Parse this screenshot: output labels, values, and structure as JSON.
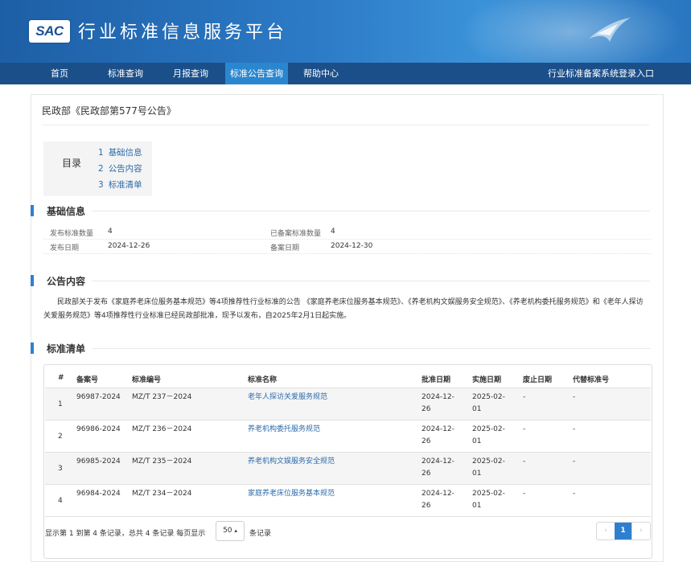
{
  "header": {
    "logo_text": "SAC",
    "site_title": "行业标准信息服务平台"
  },
  "nav": {
    "items": [
      "首页",
      "标准查询",
      "月报查询",
      "标准公告查询",
      "帮助中心"
    ],
    "active_index": 3,
    "right_link": "行业标准备案系统登录入口"
  },
  "page": {
    "title": "民政部《民政部第577号公告》"
  },
  "toc": {
    "label": "目录",
    "items": [
      {
        "num": "1",
        "label": "基础信息"
      },
      {
        "num": "2",
        "label": "公告内容"
      },
      {
        "num": "3",
        "label": "标准清单"
      }
    ]
  },
  "basic_info": {
    "title": "基础信息",
    "fields": [
      {
        "label": "发布标准数量",
        "value": "4"
      },
      {
        "label": "已备案标准数量",
        "value": "4"
      },
      {
        "label": "发布日期",
        "value": "2024-12-26"
      },
      {
        "label": "备案日期",
        "value": "2024-12-30"
      }
    ]
  },
  "notice": {
    "title": "公告内容",
    "text": "民政部关于发布《家庭养老床位服务基本规范》等4项推荐性行业标准的公告 《家庭养老床位服务基本规范》、《养老机构文娱服务安全规范》、《养老机构委托服务规范》和《老年人探访关爱服务规范》等4项推荐性行业标准已经民政部批准，现予以发布，自2025年2月1日起实施。"
  },
  "standards": {
    "title": "标准清单",
    "columns": [
      "#",
      "备案号",
      "标准编号",
      "标准名称",
      "批准日期",
      "实施日期",
      "废止日期",
      "代替标准号"
    ],
    "rows": [
      {
        "idx": "1",
        "record": "96987-2024",
        "code": "MZ/T 237－2024",
        "name": "老年人探访关爱服务规范",
        "approve_a": "2024-12-",
        "approve_b": "26",
        "impl_a": "2025-02-",
        "impl_b": "01",
        "abolish": "-",
        "replace": "-"
      },
      {
        "idx": "2",
        "record": "96986-2024",
        "code": "MZ/T 236－2024",
        "name": "养老机构委托服务规范",
        "approve_a": "2024-12-",
        "approve_b": "26",
        "impl_a": "2025-02-",
        "impl_b": "01",
        "abolish": "-",
        "replace": "-"
      },
      {
        "idx": "3",
        "record": "96985-2024",
        "code": "MZ/T 235－2024",
        "name": "养老机构文娱服务安全规范",
        "approve_a": "2024-12-",
        "approve_b": "26",
        "impl_a": "2025-02-",
        "impl_b": "01",
        "abolish": "-",
        "replace": "-"
      },
      {
        "idx": "4",
        "record": "96984-2024",
        "code": "MZ/T 234－2024",
        "name": "家庭养老床位服务基本规范",
        "approve_a": "2024-12-",
        "approve_b": "26",
        "impl_a": "2025-02-",
        "impl_b": "01",
        "abolish": "-",
        "replace": "-"
      }
    ]
  },
  "pagination": {
    "summary": "显示第 1 到第 4 条记录，总共 4 条记录 每页显示",
    "page_size": "50",
    "dropdown_arrow": "▴",
    "records_label": "条记录",
    "prev": "‹",
    "current": "1",
    "next": "›"
  },
  "colors": {
    "banner": "#2c7ac6",
    "nav": "#1b4f8a",
    "active_tab": "#2a87cf",
    "accent": "#2f7fd0",
    "link": "#2d6bab"
  }
}
